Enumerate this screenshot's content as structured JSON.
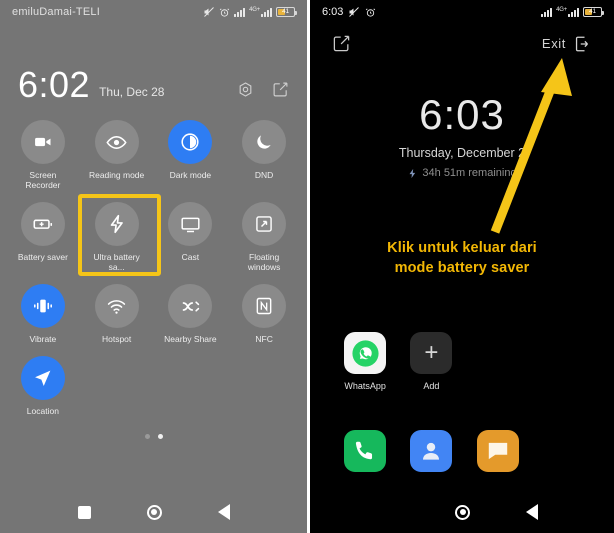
{
  "left_panel": {
    "statusbar": {
      "carrier": "emiluDamai-TELI",
      "mute_icon": "mute-icon",
      "alarm_icon": "alarm-icon",
      "signal_icon": "signal-bars-icon",
      "network_label": "4G+",
      "battery_percent": "41"
    },
    "header": {
      "clock": "6:02",
      "date": "Thu, Dec 28",
      "settings_icon": "gear-icon",
      "edit_icon": "edit-icon"
    },
    "tiles": [
      {
        "label": "Screen Recorder",
        "icon": "video-camera-icon",
        "active": false
      },
      {
        "label": "Reading mode",
        "icon": "eye-icon",
        "active": false
      },
      {
        "label": "Dark mode",
        "icon": "half-circle-contrast-icon",
        "active": true
      },
      {
        "label": "DND",
        "icon": "moon-icon",
        "active": false
      },
      {
        "label": "Battery saver",
        "icon": "battery-plus-icon",
        "active": false
      },
      {
        "label": "Ultra battery sa...",
        "icon": "lightning-bolt-icon",
        "active": false,
        "highlighted": true
      },
      {
        "label": "Cast",
        "icon": "monitor-icon",
        "active": false
      },
      {
        "label": "Floating windows",
        "icon": "floating-window-icon",
        "active": false
      },
      {
        "label": "Vibrate",
        "icon": "vibrate-icon",
        "active": true
      },
      {
        "label": "Hotspot",
        "icon": "hotspot-icon",
        "active": false
      },
      {
        "label": "Nearby Share",
        "icon": "nearby-share-icon",
        "active": false
      },
      {
        "label": "NFC",
        "icon": "nfc-icon",
        "active": false
      },
      {
        "label": "Location",
        "icon": "location-arrow-icon",
        "active": true
      }
    ],
    "page_indicator": {
      "total": 2,
      "active_index": 1
    },
    "navbar": {
      "recents_icon": "square-recents-icon",
      "home_icon": "circle-home-icon",
      "back_icon": "triangle-back-icon"
    }
  },
  "right_panel": {
    "statusbar": {
      "time": "6:03",
      "mute_icon": "mute-icon",
      "alarm_icon": "alarm-icon",
      "signal_icon": "signal-bars-icon",
      "network_label": "4G+",
      "battery_percent": "41"
    },
    "toolbar": {
      "edit_icon": "edit-icon",
      "exit_label": "Exit",
      "exit_icon": "exit-arrow-icon"
    },
    "clock_widget": {
      "clock": "6:03",
      "date": "Thursday, December 2",
      "battery_icon": "lightning-bolt-icon",
      "battery_remaining": "34h 51m remaining"
    },
    "annotation": {
      "line1": "Klik untuk keluar dari",
      "line2": "mode battery saver",
      "color": "#F2B705",
      "arrow_color": "#F5C518"
    },
    "apps": [
      {
        "label": "WhatsApp",
        "icon": "whatsapp-icon"
      },
      {
        "label": "Add",
        "icon": "plus-icon"
      }
    ],
    "dock": [
      {
        "label": "",
        "icon": "phone-icon"
      },
      {
        "label": "",
        "icon": "contacts-icon"
      },
      {
        "label": "",
        "icon": "messages-icon"
      }
    ],
    "navbar": {
      "home_icon": "circle-home-icon",
      "back_icon": "triangle-back-icon"
    }
  },
  "colors": {
    "accent_blue": "#2E7DF3",
    "highlight_yellow": "#F5C518",
    "annotation_yellow": "#F2B705",
    "panel_gray": "#757575",
    "tile_gray": "#8A8A8A"
  }
}
